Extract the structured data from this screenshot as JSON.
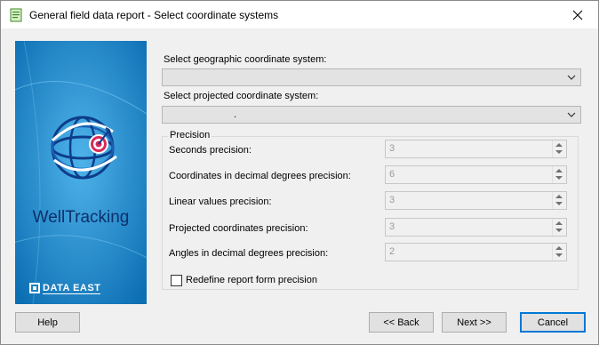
{
  "window": {
    "title": "General field data report - Select coordinate systems"
  },
  "banner": {
    "product_name": "WellTracking",
    "brand": "DATA EAST"
  },
  "geographic": {
    "label": "Select geographic coordinate system:",
    "value": ""
  },
  "projected": {
    "label": "Select projected coordinate system:",
    "value": "."
  },
  "precision": {
    "group_title": "Precision",
    "rows": [
      {
        "label": "Seconds precision:",
        "value": "3"
      },
      {
        "label": "Coordinates in decimal degrees  precision:",
        "value": "6"
      },
      {
        "label": "Linear values precision:",
        "value": "3"
      },
      {
        "label": "Projected coordinates precision:",
        "value": "3"
      },
      {
        "label": "Angles in decimal degrees precision:",
        "value": "2"
      }
    ],
    "redefine_label": "Redefine report form precision",
    "redefine_checked": false
  },
  "buttons": {
    "help": "Help",
    "back": "<< Back",
    "next": "Next >>",
    "cancel": "Cancel"
  },
  "colors": {
    "banner_bg": "#1a80c4",
    "accent": "#0078d7",
    "target_red": "#d92b5a"
  },
  "icons": {
    "app": "report-document-icon",
    "close": "close-icon",
    "dropdown": "chevron-down-icon",
    "spin_up": "spin-up-icon",
    "spin_down": "spin-down-icon"
  }
}
